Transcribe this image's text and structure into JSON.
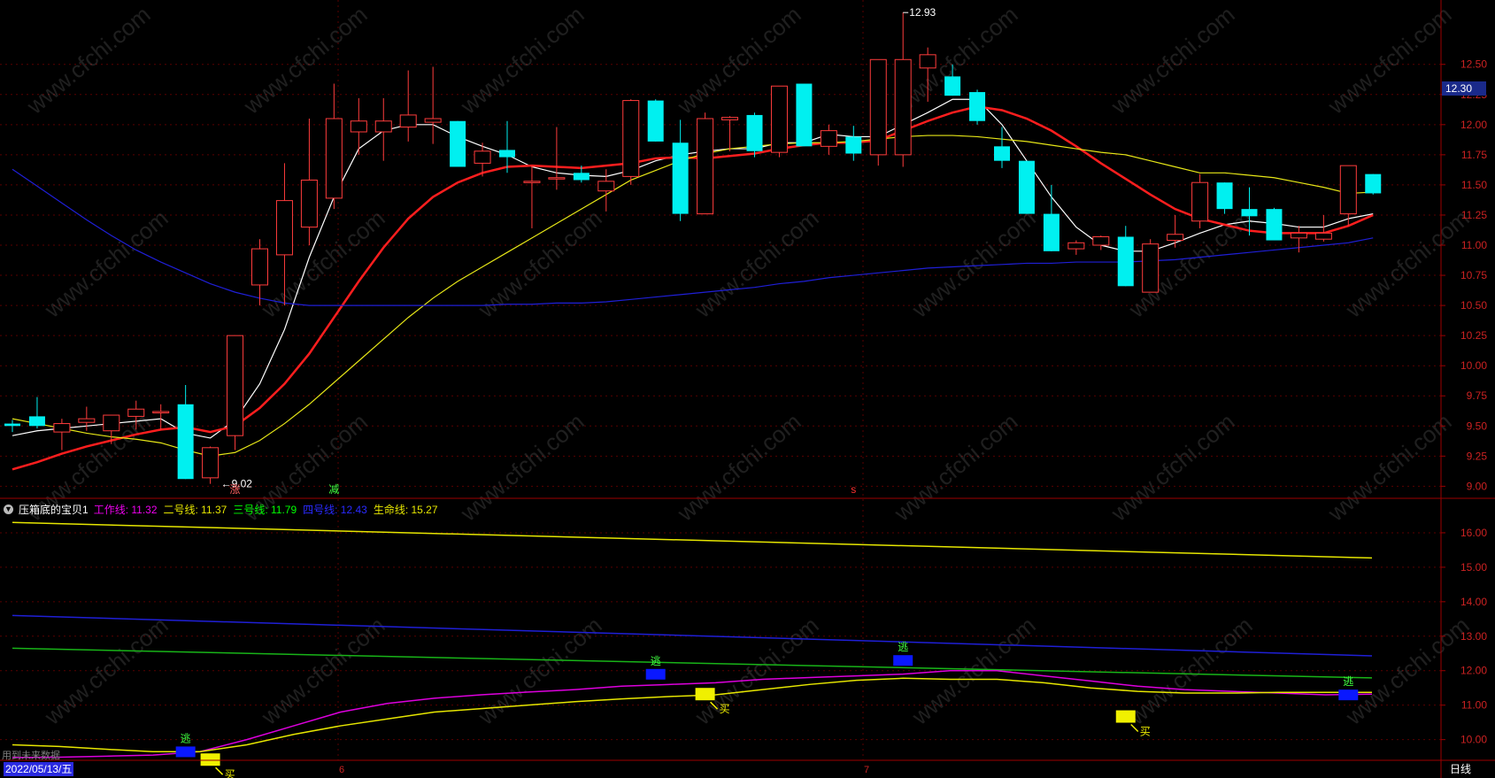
{
  "chart_data": [
    {
      "type": "candlestick",
      "panel": "main",
      "ylim": [
        8.9,
        12.99
      ],
      "price_ticks": [
        "12.50",
        "12.25",
        "12.00",
        "11.75",
        "11.50",
        "11.25",
        "11.00",
        "10.75",
        "10.50",
        "10.25",
        "10.00",
        "9.75",
        "9.50",
        "9.25",
        "9.00"
      ],
      "current_price": "12.30",
      "high_label": "12.93",
      "low_label": "9.02",
      "marks": [
        "涨",
        "减",
        "s"
      ],
      "candles": [
        {
          "o": 9.52,
          "h": 9.55,
          "l": 9.45,
          "c": 9.5
        },
        {
          "o": 9.58,
          "h": 9.74,
          "l": 9.48,
          "c": 9.5
        },
        {
          "o": 9.45,
          "h": 9.56,
          "l": 9.3,
          "c": 9.52
        },
        {
          "o": 9.53,
          "h": 9.66,
          "l": 9.46,
          "c": 9.56
        },
        {
          "o": 9.46,
          "h": 9.59,
          "l": 9.35,
          "c": 9.59
        },
        {
          "o": 9.58,
          "h": 9.71,
          "l": 9.47,
          "c": 9.64
        },
        {
          "o": 9.62,
          "h": 9.68,
          "l": 9.47,
          "c": 9.62
        },
        {
          "o": 9.68,
          "h": 9.84,
          "l": 9.06,
          "c": 9.06
        },
        {
          "o": 9.07,
          "h": 9.33,
          "l": 9.02,
          "c": 9.32
        },
        {
          "o": 9.42,
          "h": 10.25,
          "l": 9.3,
          "c": 10.25
        },
        {
          "o": 10.67,
          "h": 11.05,
          "l": 10.5,
          "c": 10.97
        },
        {
          "o": 10.92,
          "h": 11.68,
          "l": 10.5,
          "c": 11.37
        },
        {
          "o": 11.15,
          "h": 12.05,
          "l": 11.0,
          "c": 11.54
        },
        {
          "o": 11.39,
          "h": 12.34,
          "l": 11.3,
          "c": 12.05
        },
        {
          "o": 11.94,
          "h": 12.22,
          "l": 11.75,
          "c": 12.03
        },
        {
          "o": 11.94,
          "h": 12.22,
          "l": 11.7,
          "c": 12.03
        },
        {
          "o": 11.98,
          "h": 12.45,
          "l": 11.86,
          "c": 12.08
        },
        {
          "o": 12.02,
          "h": 12.48,
          "l": 11.84,
          "c": 12.05
        },
        {
          "o": 12.03,
          "h": 12.03,
          "l": 11.65,
          "c": 11.65
        },
        {
          "o": 11.68,
          "h": 11.85,
          "l": 11.57,
          "c": 11.78
        },
        {
          "o": 11.79,
          "h": 12.03,
          "l": 11.6,
          "c": 11.73
        },
        {
          "o": 11.53,
          "h": 11.66,
          "l": 11.14,
          "c": 11.53
        },
        {
          "o": 11.56,
          "h": 11.98,
          "l": 11.46,
          "c": 11.56
        },
        {
          "o": 11.6,
          "h": 11.66,
          "l": 11.52,
          "c": 11.54
        },
        {
          "o": 11.45,
          "h": 11.63,
          "l": 11.28,
          "c": 11.53
        },
        {
          "o": 11.57,
          "h": 12.21,
          "l": 11.5,
          "c": 12.2
        },
        {
          "o": 12.2,
          "h": 12.21,
          "l": 11.86,
          "c": 11.86
        },
        {
          "o": 11.85,
          "h": 12.04,
          "l": 11.2,
          "c": 11.26
        },
        {
          "o": 11.26,
          "h": 12.1,
          "l": 11.26,
          "c": 12.05
        },
        {
          "o": 12.04,
          "h": 12.07,
          "l": 11.78,
          "c": 12.06
        },
        {
          "o": 12.08,
          "h": 12.1,
          "l": 11.73,
          "c": 11.78
        },
        {
          "o": 11.77,
          "h": 12.3,
          "l": 11.73,
          "c": 12.32
        },
        {
          "o": 12.34,
          "h": 12.34,
          "l": 11.83,
          "c": 11.82
        },
        {
          "o": 11.82,
          "h": 12.0,
          "l": 11.75,
          "c": 11.95
        },
        {
          "o": 11.9,
          "h": 11.99,
          "l": 11.7,
          "c": 11.76
        },
        {
          "o": 11.75,
          "h": 12.22,
          "l": 11.66,
          "c": 12.54
        },
        {
          "o": 11.75,
          "h": 12.93,
          "l": 11.65,
          "c": 12.54
        },
        {
          "o": 12.47,
          "h": 12.64,
          "l": 12.19,
          "c": 12.58
        },
        {
          "o": 12.4,
          "h": 12.5,
          "l": 12.24,
          "c": 12.24
        },
        {
          "o": 12.27,
          "h": 12.29,
          "l": 12.0,
          "c": 12.03
        },
        {
          "o": 11.82,
          "h": 11.98,
          "l": 11.64,
          "c": 11.7
        },
        {
          "o": 11.7,
          "h": 11.7,
          "l": 11.26,
          "c": 11.26
        },
        {
          "o": 11.26,
          "h": 11.5,
          "l": 10.95,
          "c": 10.95
        },
        {
          "o": 10.97,
          "h": 11.04,
          "l": 10.92,
          "c": 11.02
        },
        {
          "o": 11.0,
          "h": 11.08,
          "l": 10.96,
          "c": 11.07
        },
        {
          "o": 11.07,
          "h": 11.16,
          "l": 10.66,
          "c": 10.66
        },
        {
          "o": 10.61,
          "h": 11.05,
          "l": 10.61,
          "c": 11.01
        },
        {
          "o": 11.04,
          "h": 11.25,
          "l": 10.98,
          "c": 11.09
        },
        {
          "o": 11.2,
          "h": 11.59,
          "l": 11.14,
          "c": 11.52
        },
        {
          "o": 11.52,
          "h": 11.52,
          "l": 11.26,
          "c": 11.3
        },
        {
          "o": 11.3,
          "h": 11.48,
          "l": 11.08,
          "c": 11.24
        },
        {
          "o": 11.3,
          "h": 11.31,
          "l": 11.05,
          "c": 11.04
        },
        {
          "o": 11.06,
          "h": 11.16,
          "l": 10.94,
          "c": 11.1
        },
        {
          "o": 11.05,
          "h": 11.25,
          "l": 11.03,
          "c": 11.1
        },
        {
          "o": 11.26,
          "h": 11.66,
          "l": 11.16,
          "c": 11.66
        },
        {
          "o": 11.59,
          "h": 11.59,
          "l": 11.42,
          "c": 11.43
        }
      ],
      "ma": [
        {
          "color": "#ffffff",
          "values": [
            9.42,
            9.46,
            9.48,
            9.5,
            9.52,
            9.54,
            9.56,
            9.44,
            9.4,
            9.55,
            9.85,
            10.3,
            10.9,
            11.4,
            11.8,
            11.95,
            12.0,
            12.0,
            11.9,
            11.82,
            11.75,
            11.65,
            11.6,
            11.58,
            11.57,
            11.62,
            11.7,
            11.75,
            11.78,
            11.8,
            11.8,
            11.85,
            11.85,
            11.92,
            11.9,
            11.9,
            12.0,
            12.1,
            12.21,
            12.21,
            12.0,
            11.7,
            11.4,
            11.15,
            11.0,
            10.95,
            10.95,
            11.02,
            11.1,
            11.17,
            11.2,
            11.18,
            11.15,
            11.15,
            11.22,
            11.26
          ]
        },
        {
          "color": "#ff1e1e",
          "values": [
            9.14,
            9.2,
            9.27,
            9.33,
            9.38,
            9.43,
            9.47,
            9.49,
            9.45,
            9.5,
            9.65,
            9.85,
            10.1,
            10.4,
            10.7,
            10.98,
            11.22,
            11.4,
            11.52,
            11.6,
            11.65,
            11.66,
            11.65,
            11.64,
            11.66,
            11.68,
            11.72,
            11.73,
            11.72,
            11.74,
            11.76,
            11.8,
            11.83,
            11.85,
            11.85,
            11.87,
            11.95,
            12.03,
            12.1,
            12.15,
            12.12,
            12.05,
            11.95,
            11.82,
            11.68,
            11.55,
            11.42,
            11.3,
            11.22,
            11.17,
            11.12,
            11.1,
            11.1,
            11.1,
            11.16,
            11.25
          ]
        },
        {
          "color": "#e6e617",
          "values": [
            9.56,
            9.52,
            9.48,
            9.44,
            9.41,
            9.39,
            9.36,
            9.3,
            9.25,
            9.28,
            9.38,
            9.52,
            9.68,
            9.86,
            10.04,
            10.22,
            10.4,
            10.56,
            10.7,
            10.82,
            10.94,
            11.06,
            11.18,
            11.3,
            11.42,
            11.54,
            11.62,
            11.7,
            11.76,
            11.8,
            11.82,
            11.84,
            11.85,
            11.85,
            11.86,
            11.88,
            11.9,
            11.91,
            11.91,
            11.9,
            11.88,
            11.86,
            11.83,
            11.8,
            11.77,
            11.75,
            11.7,
            11.65,
            11.6,
            11.6,
            11.58,
            11.56,
            11.52,
            11.48,
            11.43,
            11.44
          ]
        },
        {
          "color": "#1f1fd6",
          "values": [
            11.63,
            11.49,
            11.35,
            11.21,
            11.08,
            10.96,
            10.86,
            10.77,
            10.68,
            10.61,
            10.56,
            10.52,
            10.5,
            10.5,
            10.5,
            10.5,
            10.5,
            10.5,
            10.5,
            10.5,
            10.51,
            10.51,
            10.52,
            10.52,
            10.53,
            10.55,
            10.57,
            10.59,
            10.61,
            10.63,
            10.65,
            10.68,
            10.7,
            10.73,
            10.75,
            10.77,
            10.79,
            10.81,
            10.82,
            10.83,
            10.84,
            10.85,
            10.85,
            10.86,
            10.86,
            10.86,
            10.87,
            10.88,
            10.9,
            10.92,
            10.94,
            10.96,
            10.98,
            11.0,
            11.02,
            11.06
          ]
        }
      ]
    },
    {
      "type": "line",
      "panel": "indicator",
      "ylim": [
        9.4,
        17.0
      ],
      "ticks": [
        "16.00",
        "15.00",
        "14.00",
        "13.00",
        "12.00",
        "11.00",
        "10.00"
      ],
      "series": [
        {
          "name": "生命线",
          "color": "#e6e600",
          "values": [
            16.3,
            15.27
          ]
        },
        {
          "name": "四号线",
          "color": "#1f1fd6",
          "values": [
            13.6,
            12.43
          ]
        },
        {
          "name": "三号线",
          "color": "#18b418",
          "values": [
            12.65,
            11.79
          ]
        },
        {
          "name": "工作线",
          "color": "#dd00dd",
          "values": [
            9.48,
            9.49,
            9.52,
            9.55,
            9.65,
            10.0,
            10.4,
            10.8,
            11.05,
            11.2,
            11.3,
            11.38,
            11.45,
            11.55,
            11.6,
            11.65,
            11.75,
            11.8,
            11.85,
            11.9,
            12.0,
            12.0,
            11.85,
            11.7,
            11.55,
            11.45,
            11.4,
            11.35,
            11.3,
            11.32
          ]
        },
        {
          "name": "二号线",
          "color": "#e6e600",
          "values": [
            9.85,
            9.8,
            9.72,
            9.65,
            9.65,
            9.85,
            10.15,
            10.4,
            10.6,
            10.8,
            10.9,
            11.0,
            11.1,
            11.18,
            11.25,
            11.3,
            11.45,
            11.6,
            11.72,
            11.78,
            11.75,
            11.75,
            11.65,
            11.5,
            11.4,
            11.35,
            11.35,
            11.37,
            11.37,
            11.37
          ]
        }
      ],
      "signals": [
        {
          "label": "逃",
          "kind": "sell",
          "index": 7,
          "value": 9.8
        },
        {
          "label": "买",
          "kind": "buy",
          "index": 8,
          "value": 9.6
        },
        {
          "label": "逃",
          "kind": "sell",
          "index": 26,
          "value": 12.05
        },
        {
          "label": "买",
          "kind": "buy",
          "index": 28,
          "value": 11.5
        },
        {
          "label": "逃",
          "kind": "sell",
          "index": 36,
          "value": 12.45
        },
        {
          "label": "买",
          "kind": "buy",
          "index": 45,
          "value": 10.85
        },
        {
          "label": "逃",
          "kind": "sell",
          "index": 54,
          "value": 11.45
        }
      ]
    }
  ],
  "indicator_legend": {
    "name": "压箱底的宝贝1",
    "items": [
      {
        "label": "工作线: 11.32",
        "color": "#ee00ee"
      },
      {
        "label": "二号线: 11.37",
        "color": "#e6e600"
      },
      {
        "label": "三号线: 11.79",
        "color": "#00ff00"
      },
      {
        "label": "四号线: 12.43",
        "color": "#2a2aff"
      },
      {
        "label": "生命线: 15.27",
        "color": "#e6e600"
      }
    ]
  },
  "footer": {
    "future_data_text": "用到未来数据",
    "date_text": "2022/05/13/五",
    "month_labels": [
      "6",
      "7"
    ],
    "period_label": "日线"
  },
  "watermark": "www.cfchi.com"
}
